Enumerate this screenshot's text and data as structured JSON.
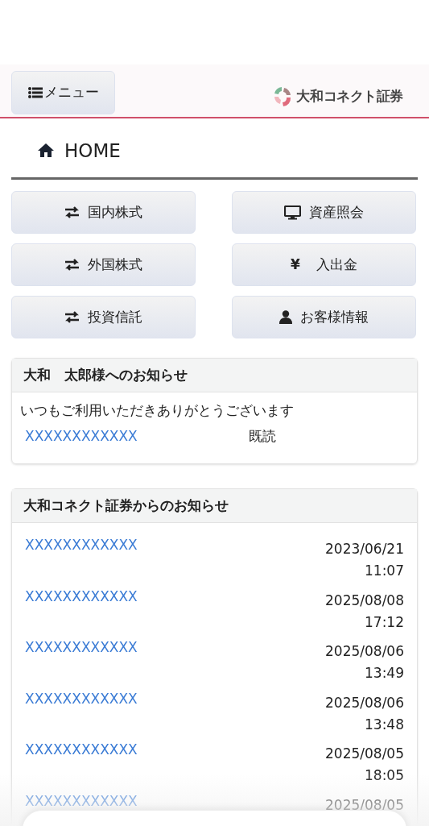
{
  "header": {
    "menu_button": "メニュー",
    "logo_text": "大和コネクト証券"
  },
  "page_title": "HOME",
  "nav_buttons": [
    {
      "kind": "exchange",
      "label": "国内株式"
    },
    {
      "kind": "monitor",
      "label": "資産照会"
    },
    {
      "kind": "exchange",
      "label": "外国株式"
    },
    {
      "kind": "yen",
      "label": "入出金",
      "icon_text": "¥"
    },
    {
      "kind": "exchange",
      "label": "投資信託"
    },
    {
      "kind": "person",
      "label": "お客様情報"
    }
  ],
  "personal_notices": {
    "title": "大和　太郎様へのお知らせ",
    "message": "いつもご利用いただきありがとうございます",
    "items": [
      {
        "link": "XXXXXXXXXXXX",
        "status": "既読"
      }
    ]
  },
  "company_notices": {
    "title": "大和コネクト証券からのお知らせ",
    "items": [
      {
        "link": "XXXXXXXXXXXX",
        "date": "2023/06/21",
        "time": "11:07"
      },
      {
        "link": "XXXXXXXXXXXX",
        "date": "2025/08/08",
        "time": "17:12"
      },
      {
        "link": "XXXXXXXXXXXX",
        "date": "2025/08/06",
        "time": "13:49"
      },
      {
        "link": "XXXXXXXXXXXX",
        "date": "2025/08/06",
        "time": "13:48"
      },
      {
        "link": "XXXXXXXXXXXX",
        "date": "2025/08/05",
        "time": "18:05"
      },
      {
        "link": "XXXXXXXXXXXX",
        "date": "2025/08/05"
      }
    ]
  }
}
